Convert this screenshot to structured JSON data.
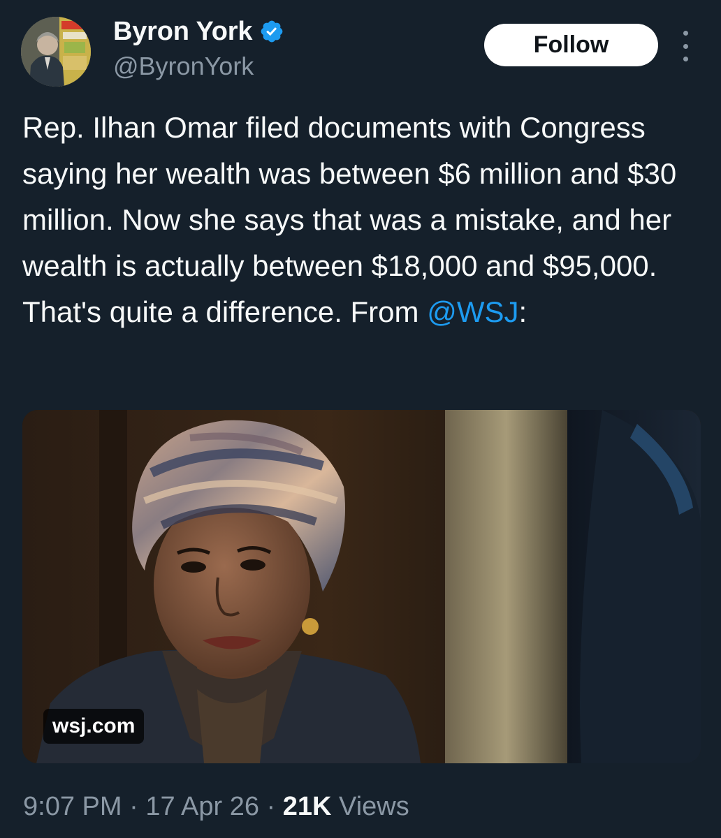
{
  "author": {
    "display_name": "Byron York",
    "handle": "@ByronYork",
    "verified": true,
    "avatar_icon": "profile-photo"
  },
  "actions": {
    "follow_label": "Follow",
    "more_icon": "vertical-ellipsis-icon"
  },
  "tweet": {
    "text_before_mention": "Rep. Ilhan Omar filed documents with Congress saying her wealth was between $6 million and $30 million. Now she says that was a mistake, and her wealth is actually between $18,000 and $95,000. That's quite a difference. From ",
    "mention": "@WSJ",
    "text_after_mention": ":"
  },
  "media": {
    "source_label": "wsj.com"
  },
  "meta": {
    "time": "9:07 PM",
    "separator": " · ",
    "date": "17 Apr 26",
    "views_count": "21K",
    "views_label": " Views"
  },
  "colors": {
    "background": "#15202b",
    "text_primary": "#f7f9f9",
    "text_secondary": "#8b98a5",
    "link": "#1d9bf0",
    "verified_badge": "#1d9bf0",
    "follow_button_bg": "#ffffff"
  }
}
